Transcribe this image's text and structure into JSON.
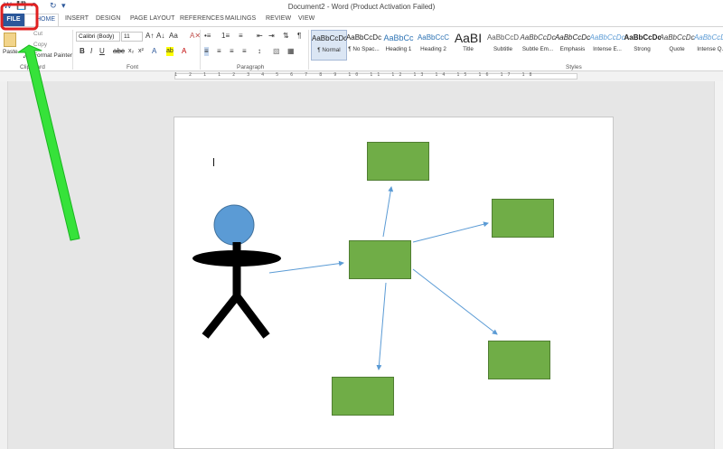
{
  "window": {
    "title": "Document2 - Word (Product Activation Failed)",
    "qat": {
      "save": "💾",
      "undo": "↶",
      "redo": "↻",
      "customize": "▾"
    }
  },
  "tabs": {
    "file": "FILE",
    "home": "HOME",
    "items": [
      "INSERT",
      "DESIGN",
      "PAGE LAYOUT",
      "REFERENCES",
      "MAILINGS",
      "REVIEW",
      "VIEW"
    ]
  },
  "ribbon": {
    "clipboard": {
      "paste": "Paste",
      "cut": "Cut",
      "copy": "Copy",
      "format_painter": "Format Painter",
      "label": "Clipboard"
    },
    "font": {
      "name": "Calibri (Body)",
      "size": "11",
      "label": "Font"
    },
    "paragraph": {
      "label": "Paragraph"
    },
    "styles": {
      "label": "Styles",
      "items": [
        {
          "sample": "AaBbCcDc",
          "name": "¶ Normal"
        },
        {
          "sample": "AaBbCcDc",
          "name": "¶ No Spac..."
        },
        {
          "sample": "AaBbCc",
          "name": "Heading 1"
        },
        {
          "sample": "AaBbCcC",
          "name": "Heading 2"
        },
        {
          "sample": "AaBI",
          "name": "Title"
        },
        {
          "sample": "AaBbCcD",
          "name": "Subtitle"
        },
        {
          "sample": "AaBbCcDc",
          "name": "Subtle Em..."
        },
        {
          "sample": "AaBbCcDc",
          "name": "Emphasis"
        },
        {
          "sample": "AaBbCcDc",
          "name": "Intense E..."
        },
        {
          "sample": "AaBbCcDc",
          "name": "Strong"
        },
        {
          "sample": "AaBbCcDc",
          "name": "Quote"
        },
        {
          "sample": "AaBbCcDc",
          "name": "Intense Q..."
        }
      ]
    }
  },
  "ruler": {
    "numbers": "1 2 1 1 2 3 4 5 6 7 8 9 10 11 12 13 14 15 16 17 18"
  },
  "colors": {
    "accent": "#2b579a",
    "box_fill": "#70ad47",
    "head": "#5b9bd5",
    "arrow": "#5b9bd5",
    "highlight": "#e02020",
    "pointer": "#36e23a"
  }
}
